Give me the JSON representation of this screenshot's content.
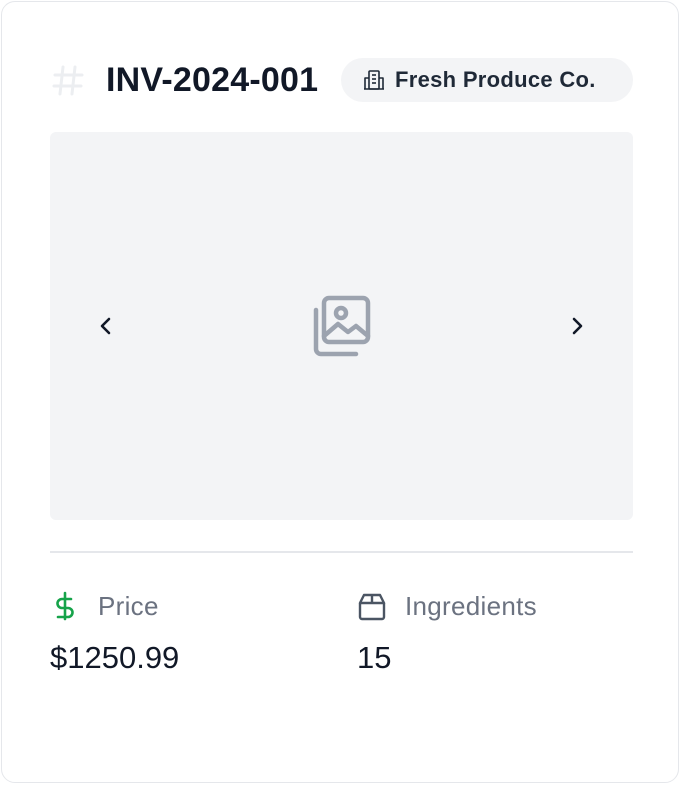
{
  "invoice": {
    "id": "INV-2024-001",
    "supplier": "Fresh Produce Co."
  },
  "icons": {
    "id_icon": "hash-icon",
    "supplier_icon": "building-icon",
    "image_placeholder": "images-icon",
    "prev": "chevron-left-icon",
    "next": "chevron-right-icon",
    "price_icon": "dollar-icon",
    "ingredients_icon": "box-icon"
  },
  "stats": {
    "price": {
      "label": "Price",
      "value": "$1250.99"
    },
    "ingredients": {
      "label": "Ingredients",
      "value": "15"
    }
  },
  "colors": {
    "price_icon": "#16a34a",
    "muted": "#6b7280",
    "placeholder_icon": "#9ca3af",
    "media_bg": "#f3f4f6"
  }
}
